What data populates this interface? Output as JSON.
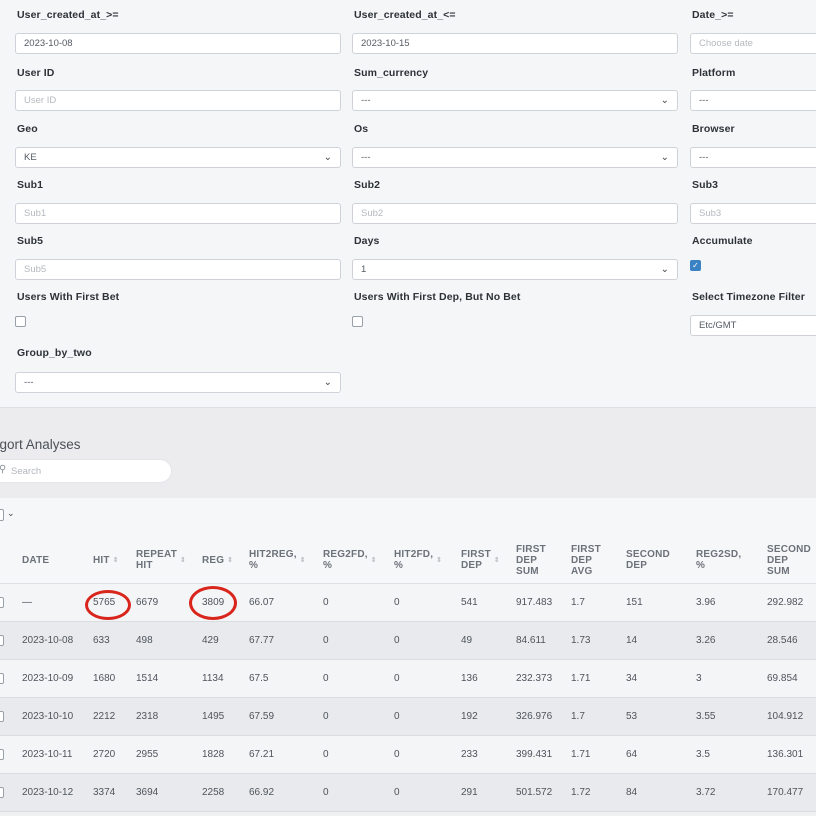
{
  "filters": {
    "user_created_from": {
      "label": "User_created_at_>=",
      "value": "2023-10-08"
    },
    "user_created_to": {
      "label": "User_created_at_<=",
      "value": "2023-10-15"
    },
    "date_from": {
      "label": "Date_>=",
      "placeholder": "Choose date"
    },
    "user_id": {
      "label": "User ID",
      "placeholder": "User ID"
    },
    "sum_currency": {
      "label": "Sum_currency",
      "value": "---"
    },
    "platform": {
      "label": "Platform",
      "value": "---"
    },
    "geo": {
      "label": "Geo",
      "value": "KE"
    },
    "os": {
      "label": "Os",
      "value": "---"
    },
    "browser": {
      "label": "Browser",
      "value": "---"
    },
    "sub1": {
      "label": "Sub1",
      "placeholder": "Sub1"
    },
    "sub2": {
      "label": "Sub2",
      "placeholder": "Sub2"
    },
    "sub3": {
      "label": "Sub3",
      "placeholder": "Sub3"
    },
    "sub5": {
      "label": "Sub5",
      "placeholder": "Sub5"
    },
    "days": {
      "label": "Days",
      "value": "1"
    },
    "accumulate": {
      "label": "Accumulate",
      "checked": true,
      "check_glyph": "✓"
    },
    "users_first_bet": {
      "label": "Users With First Bet",
      "checked": false
    },
    "users_first_dep_no_bet": {
      "label": "Users With First Dep, But No Bet",
      "checked": false
    },
    "timezone": {
      "label": "Select Timezone Filter",
      "value": "Etc/GMT"
    },
    "group_by_two": {
      "label": "Group_by_two",
      "value": "---"
    },
    "chevron_glyph": "⌄"
  },
  "analyses": {
    "title": "agort Analyses",
    "search_placeholder": "Search",
    "search_icon_glyph": "⚲",
    "rows_chevron": "⌄"
  },
  "table": {
    "sort_glyph": "⇕",
    "columns": [
      {
        "line1": "DATE",
        "line2": "",
        "line3": "",
        "sortable": false
      },
      {
        "line1": "HIT",
        "line2": "",
        "line3": "",
        "sortable": true
      },
      {
        "line1": "REPEAT",
        "line2": "HIT",
        "line3": "",
        "sortable": true
      },
      {
        "line1": "REG",
        "line2": "",
        "line3": "",
        "sortable": true
      },
      {
        "line1": "HIT2REG,",
        "line2": "%",
        "line3": "",
        "sortable": true
      },
      {
        "line1": "REG2FD,",
        "line2": "%",
        "line3": "",
        "sortable": true
      },
      {
        "line1": "HIT2FD,",
        "line2": "%",
        "line3": "",
        "sortable": true
      },
      {
        "line1": "FIRST",
        "line2": "DEP",
        "line3": "",
        "sortable": true
      },
      {
        "line1": "FIRST",
        "line2": "DEP",
        "line3": "SUM",
        "sortable": false
      },
      {
        "line1": "FIRST",
        "line2": "DEP",
        "line3": "AVG",
        "sortable": false
      },
      {
        "line1": "SECOND",
        "line2": "DEP",
        "line3": "",
        "sortable": false
      },
      {
        "line1": "REG2SD,",
        "line2": "%",
        "line3": "",
        "sortable": false
      },
      {
        "line1": "SECOND",
        "line2": "DEP",
        "line3": "SUM",
        "sortable": false
      }
    ],
    "rows": [
      [
        "—",
        "5765",
        "6679",
        "3809",
        "66.07",
        "0",
        "0",
        "541",
        "917.483",
        "1.7",
        "151",
        "3.96",
        "292.982"
      ],
      [
        "2023-10-08",
        "633",
        "498",
        "429",
        "67.77",
        "0",
        "0",
        "49",
        "84.611",
        "1.73",
        "14",
        "3.26",
        "28.546"
      ],
      [
        "2023-10-09",
        "1680",
        "1514",
        "1134",
        "67.5",
        "0",
        "0",
        "136",
        "232.373",
        "1.71",
        "34",
        "3",
        "69.854"
      ],
      [
        "2023-10-10",
        "2212",
        "2318",
        "1495",
        "67.59",
        "0",
        "0",
        "192",
        "326.976",
        "1.7",
        "53",
        "3.55",
        "104.912"
      ],
      [
        "2023-10-11",
        "2720",
        "2955",
        "1828",
        "67.21",
        "0",
        "0",
        "233",
        "399.431",
        "1.71",
        "64",
        "3.5",
        "136.301"
      ],
      [
        "2023-10-12",
        "3374",
        "3694",
        "2258",
        "66.92",
        "0",
        "0",
        "291",
        "501.572",
        "1.72",
        "84",
        "3.72",
        "170.477"
      ]
    ],
    "highlight_color": "#d9261c"
  }
}
